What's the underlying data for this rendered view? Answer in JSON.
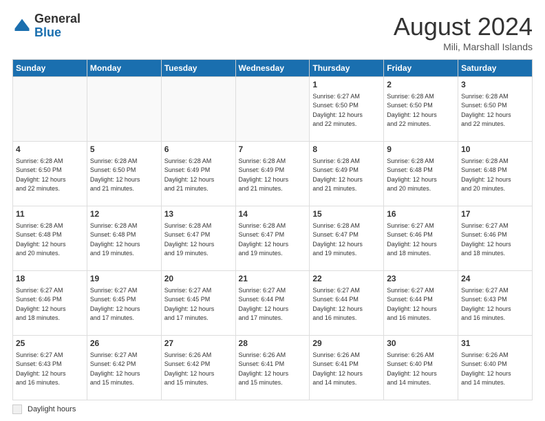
{
  "header": {
    "logo_general": "General",
    "logo_blue": "Blue",
    "month_title": "August 2024",
    "location": "Mili, Marshall Islands"
  },
  "legend": {
    "label": "Daylight hours"
  },
  "days_of_week": [
    "Sunday",
    "Monday",
    "Tuesday",
    "Wednesday",
    "Thursday",
    "Friday",
    "Saturday"
  ],
  "weeks": [
    [
      {
        "day": "",
        "info": ""
      },
      {
        "day": "",
        "info": ""
      },
      {
        "day": "",
        "info": ""
      },
      {
        "day": "",
        "info": ""
      },
      {
        "day": "1",
        "info": "Sunrise: 6:27 AM\nSunset: 6:50 PM\nDaylight: 12 hours\nand 22 minutes."
      },
      {
        "day": "2",
        "info": "Sunrise: 6:28 AM\nSunset: 6:50 PM\nDaylight: 12 hours\nand 22 minutes."
      },
      {
        "day": "3",
        "info": "Sunrise: 6:28 AM\nSunset: 6:50 PM\nDaylight: 12 hours\nand 22 minutes."
      }
    ],
    [
      {
        "day": "4",
        "info": "Sunrise: 6:28 AM\nSunset: 6:50 PM\nDaylight: 12 hours\nand 22 minutes."
      },
      {
        "day": "5",
        "info": "Sunrise: 6:28 AM\nSunset: 6:50 PM\nDaylight: 12 hours\nand 21 minutes."
      },
      {
        "day": "6",
        "info": "Sunrise: 6:28 AM\nSunset: 6:49 PM\nDaylight: 12 hours\nand 21 minutes."
      },
      {
        "day": "7",
        "info": "Sunrise: 6:28 AM\nSunset: 6:49 PM\nDaylight: 12 hours\nand 21 minutes."
      },
      {
        "day": "8",
        "info": "Sunrise: 6:28 AM\nSunset: 6:49 PM\nDaylight: 12 hours\nand 21 minutes."
      },
      {
        "day": "9",
        "info": "Sunrise: 6:28 AM\nSunset: 6:48 PM\nDaylight: 12 hours\nand 20 minutes."
      },
      {
        "day": "10",
        "info": "Sunrise: 6:28 AM\nSunset: 6:48 PM\nDaylight: 12 hours\nand 20 minutes."
      }
    ],
    [
      {
        "day": "11",
        "info": "Sunrise: 6:28 AM\nSunset: 6:48 PM\nDaylight: 12 hours\nand 20 minutes."
      },
      {
        "day": "12",
        "info": "Sunrise: 6:28 AM\nSunset: 6:48 PM\nDaylight: 12 hours\nand 19 minutes."
      },
      {
        "day": "13",
        "info": "Sunrise: 6:28 AM\nSunset: 6:47 PM\nDaylight: 12 hours\nand 19 minutes."
      },
      {
        "day": "14",
        "info": "Sunrise: 6:28 AM\nSunset: 6:47 PM\nDaylight: 12 hours\nand 19 minutes."
      },
      {
        "day": "15",
        "info": "Sunrise: 6:28 AM\nSunset: 6:47 PM\nDaylight: 12 hours\nand 19 minutes."
      },
      {
        "day": "16",
        "info": "Sunrise: 6:27 AM\nSunset: 6:46 PM\nDaylight: 12 hours\nand 18 minutes."
      },
      {
        "day": "17",
        "info": "Sunrise: 6:27 AM\nSunset: 6:46 PM\nDaylight: 12 hours\nand 18 minutes."
      }
    ],
    [
      {
        "day": "18",
        "info": "Sunrise: 6:27 AM\nSunset: 6:46 PM\nDaylight: 12 hours\nand 18 minutes."
      },
      {
        "day": "19",
        "info": "Sunrise: 6:27 AM\nSunset: 6:45 PM\nDaylight: 12 hours\nand 17 minutes."
      },
      {
        "day": "20",
        "info": "Sunrise: 6:27 AM\nSunset: 6:45 PM\nDaylight: 12 hours\nand 17 minutes."
      },
      {
        "day": "21",
        "info": "Sunrise: 6:27 AM\nSunset: 6:44 PM\nDaylight: 12 hours\nand 17 minutes."
      },
      {
        "day": "22",
        "info": "Sunrise: 6:27 AM\nSunset: 6:44 PM\nDaylight: 12 hours\nand 16 minutes."
      },
      {
        "day": "23",
        "info": "Sunrise: 6:27 AM\nSunset: 6:44 PM\nDaylight: 12 hours\nand 16 minutes."
      },
      {
        "day": "24",
        "info": "Sunrise: 6:27 AM\nSunset: 6:43 PM\nDaylight: 12 hours\nand 16 minutes."
      }
    ],
    [
      {
        "day": "25",
        "info": "Sunrise: 6:27 AM\nSunset: 6:43 PM\nDaylight: 12 hours\nand 16 minutes."
      },
      {
        "day": "26",
        "info": "Sunrise: 6:27 AM\nSunset: 6:42 PM\nDaylight: 12 hours\nand 15 minutes."
      },
      {
        "day": "27",
        "info": "Sunrise: 6:26 AM\nSunset: 6:42 PM\nDaylight: 12 hours\nand 15 minutes."
      },
      {
        "day": "28",
        "info": "Sunrise: 6:26 AM\nSunset: 6:41 PM\nDaylight: 12 hours\nand 15 minutes."
      },
      {
        "day": "29",
        "info": "Sunrise: 6:26 AM\nSunset: 6:41 PM\nDaylight: 12 hours\nand 14 minutes."
      },
      {
        "day": "30",
        "info": "Sunrise: 6:26 AM\nSunset: 6:40 PM\nDaylight: 12 hours\nand 14 minutes."
      },
      {
        "day": "31",
        "info": "Sunrise: 6:26 AM\nSunset: 6:40 PM\nDaylight: 12 hours\nand 14 minutes."
      }
    ]
  ]
}
